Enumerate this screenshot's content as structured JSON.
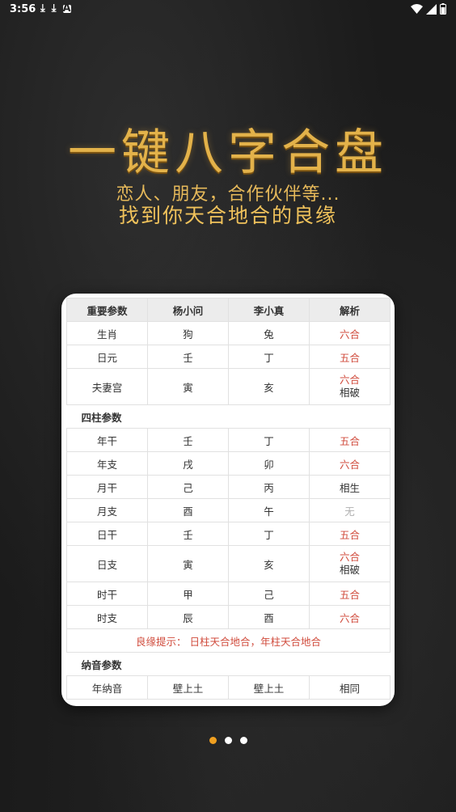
{
  "status_bar": {
    "time": "3:56"
  },
  "hero": {
    "title": "一键八字合盘",
    "subtitle1": "恋人、朋友，合作伙伴等...",
    "subtitle2": "找到你天合地合的良缘"
  },
  "table": {
    "headers": [
      "重要参数",
      "杨小问",
      "李小真",
      "解析"
    ],
    "basic_rows": [
      {
        "param": "生肖",
        "a": "狗",
        "b": "兔",
        "result": "六合"
      },
      {
        "param": "日元",
        "a": "壬",
        "b": "丁",
        "result": "五合"
      },
      {
        "param": "夫妻宫",
        "a": "寅",
        "b": "亥",
        "result": "六合",
        "result2": "相破"
      }
    ],
    "section_pillars": "四柱参数",
    "pillar_rows": [
      {
        "param": "年干",
        "a": "壬",
        "b": "丁",
        "result": "五合"
      },
      {
        "param": "年支",
        "a": "戌",
        "b": "卯",
        "result": "六合"
      },
      {
        "param": "月干",
        "a": "己",
        "b": "丙",
        "result": "相生"
      },
      {
        "param": "月支",
        "a": "酉",
        "b": "午",
        "result": "无"
      },
      {
        "param": "日干",
        "a": "壬",
        "b": "丁",
        "result": "五合"
      },
      {
        "param": "日支",
        "a": "寅",
        "b": "亥",
        "result": "六合",
        "result2": "相破"
      },
      {
        "param": "时干",
        "a": "甲",
        "b": "己",
        "result": "五合"
      },
      {
        "param": "时支",
        "a": "辰",
        "b": "酉",
        "result": "六合"
      }
    ],
    "tip": "良缘提示：  日柱天合地合，年柱天合地合",
    "section_nayin": "纳音参数",
    "nayin_rows": [
      {
        "param": "年纳音",
        "a": "壁上土",
        "b": "壁上土",
        "result": "相同"
      }
    ]
  },
  "colors": {
    "accent_gold": "#e3b24a",
    "result_red": "#d04b3c",
    "page_dot_active": "#f0a020"
  },
  "pager": {
    "count": 3,
    "active": 1
  }
}
